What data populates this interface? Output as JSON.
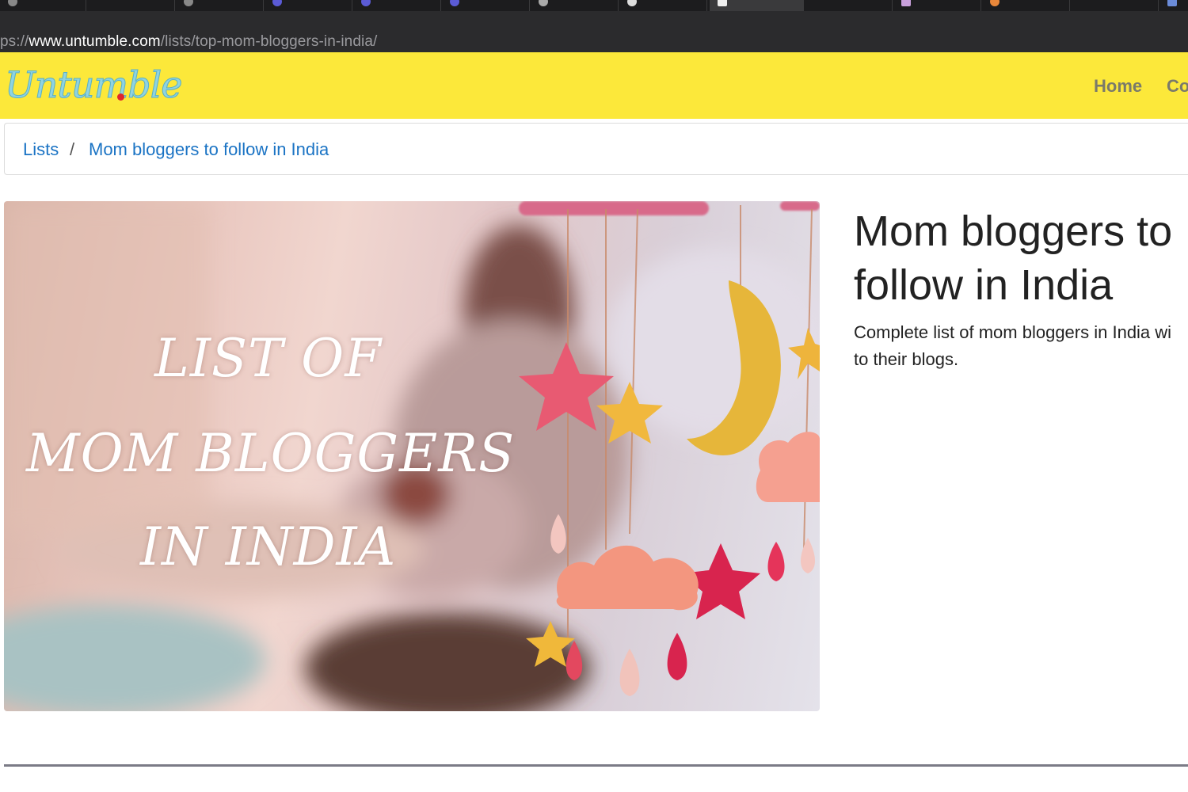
{
  "browser": {
    "url_prefix": "ps://",
    "url_host": "www.untumble.com",
    "url_path": "/lists/top-mom-bloggers-in-india/"
  },
  "navbar": {
    "brand": "Untumble",
    "links": [
      "Home",
      "Co"
    ],
    "background_color": "#fce83a"
  },
  "breadcrumb": {
    "items": [
      "Lists",
      "Mom bloggers to follow in India"
    ],
    "separator": "/"
  },
  "hero": {
    "lines": [
      "LIST OF",
      "MOM BLOGGERS",
      "IN INDIA"
    ]
  },
  "article": {
    "title_line1": "Mom bloggers to",
    "title_line2": "follow in India",
    "desc_line1": "Complete list of mom bloggers in India wi",
    "desc_line2": "to their blogs."
  }
}
